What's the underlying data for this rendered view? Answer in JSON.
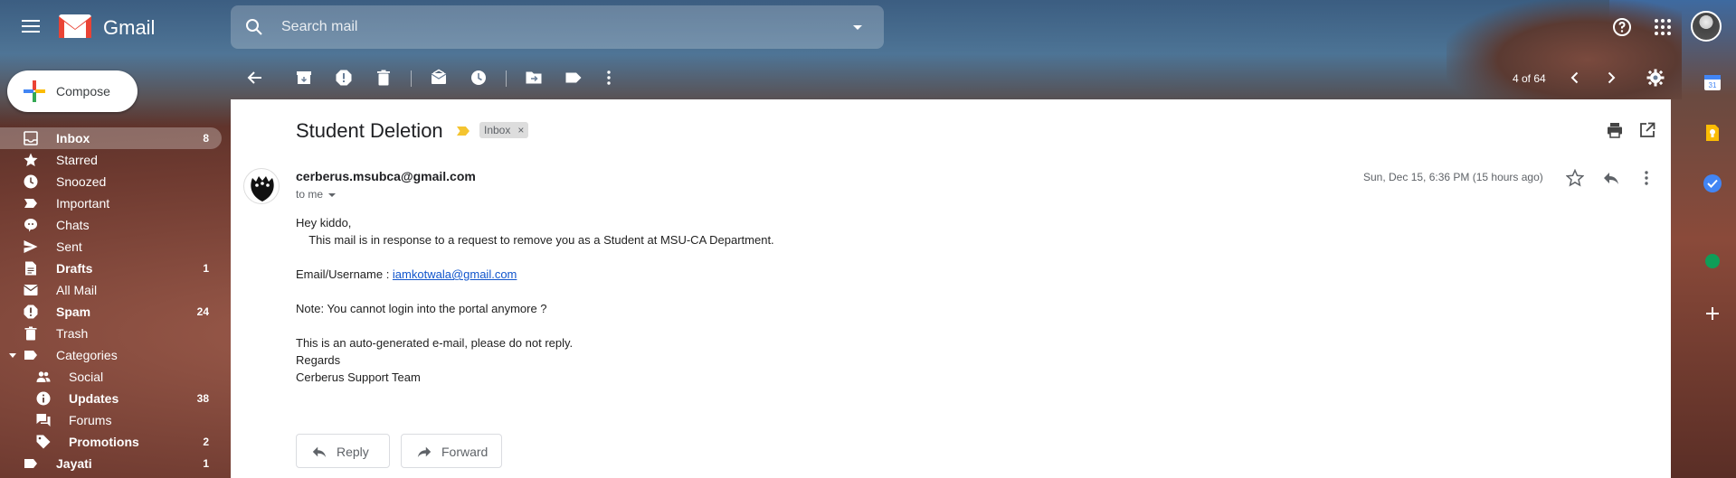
{
  "app": {
    "name": "Gmail"
  },
  "search": {
    "placeholder": "Search mail"
  },
  "compose": {
    "label": "Compose"
  },
  "sidebar": {
    "items": [
      {
        "label": "Inbox",
        "count": "8",
        "icon": "inbox-icon"
      },
      {
        "label": "Starred",
        "count": "",
        "icon": "star-icon"
      },
      {
        "label": "Snoozed",
        "count": "",
        "icon": "clock-icon"
      },
      {
        "label": "Important",
        "count": "",
        "icon": "important-icon"
      },
      {
        "label": "Chats",
        "count": "",
        "icon": "chat-icon"
      },
      {
        "label": "Sent",
        "count": "",
        "icon": "send-icon"
      },
      {
        "label": "Drafts",
        "count": "1",
        "icon": "draft-icon"
      },
      {
        "label": "All Mail",
        "count": "",
        "icon": "mail-icon"
      },
      {
        "label": "Spam",
        "count": "24",
        "icon": "spam-icon"
      },
      {
        "label": "Trash",
        "count": "",
        "icon": "trash-icon"
      },
      {
        "label": "Categories",
        "count": "",
        "icon": "label-icon"
      },
      {
        "label": "Social",
        "count": "",
        "icon": "people-icon"
      },
      {
        "label": "Updates",
        "count": "38",
        "icon": "info-icon"
      },
      {
        "label": "Forums",
        "count": "",
        "icon": "forum-icon"
      },
      {
        "label": "Promotions",
        "count": "2",
        "icon": "tag-icon"
      },
      {
        "label": "Jayati",
        "count": "1",
        "icon": "label-icon"
      }
    ]
  },
  "toolbar": {
    "pager": "4 of 64"
  },
  "email": {
    "subject": "Student Deletion",
    "label_chip": "Inbox",
    "chip_close": "×",
    "sender": "cerberus.msubca@gmail.com",
    "to": "to me",
    "date": "Sun, Dec 15, 6:36 PM (15 hours ago)",
    "body": {
      "greeting": "Hey kiddo,",
      "line1": "    This mail is in response to a request to remove you as a Student at MSU-CA Department.",
      "email_label": "Email/Username : ",
      "email_link": "iamkotwala@gmail.com",
      "note": "Note: You cannot login into the portal anymore ?",
      "auto": "This is an auto-generated e-mail, please do not reply.",
      "regards": "Regards",
      "signature": "Cerberus Support Team"
    },
    "reply_label": "Reply",
    "forward_label": "Forward"
  },
  "colors": {
    "accent": "#1a73e8",
    "important": "#f4c430",
    "link": "#1155cc"
  }
}
